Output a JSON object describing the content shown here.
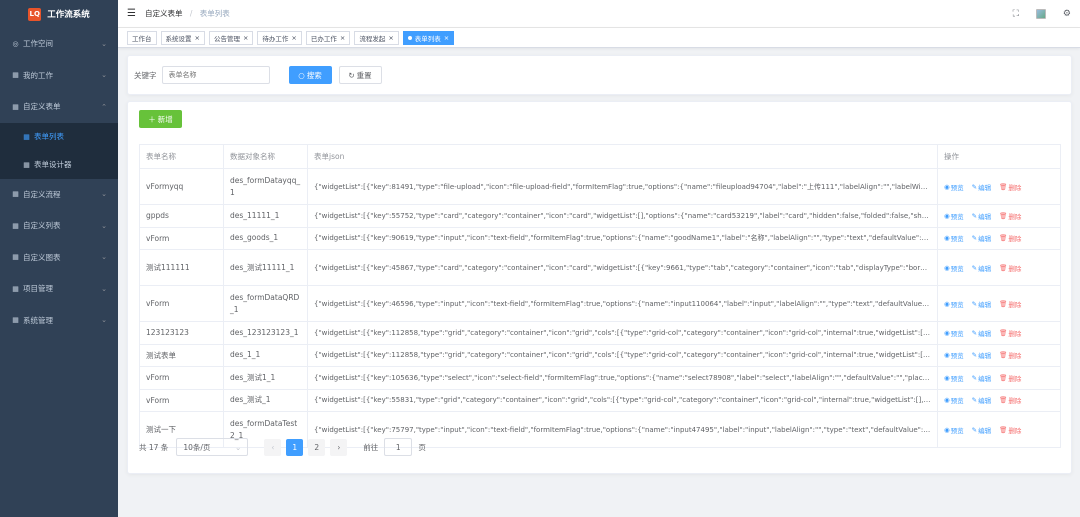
{
  "app": {
    "logo_mark": "LQ",
    "title": "工作流系统"
  },
  "sidebar": {
    "items": [
      {
        "icon": "◎",
        "label": "工作空间",
        "chev": "⌄"
      },
      {
        "icon": "▦",
        "label": "我的工作",
        "chev": "⌄"
      },
      {
        "icon": "▦",
        "label": "自定义表单",
        "chev": "⌃"
      },
      {
        "icon": "▦",
        "label": "自定义流程",
        "chev": "⌄"
      },
      {
        "icon": "▦",
        "label": "自定义列表",
        "chev": "⌄"
      },
      {
        "icon": "▦",
        "label": "自定义图表",
        "chev": "⌄"
      },
      {
        "icon": "▦",
        "label": "项目管理",
        "chev": "⌄"
      },
      {
        "icon": "▦",
        "label": "系统管理",
        "chev": "⌄"
      }
    ],
    "submenu": [
      {
        "icon": "▦",
        "label": "表单列表"
      },
      {
        "icon": "▦",
        "label": "表单设计器"
      }
    ]
  },
  "header": {
    "breadcrumb_1": "自定义表单",
    "breadcrumb_sep": "/",
    "breadcrumb_2": "表单列表"
  },
  "tabs": [
    {
      "label": "工作台",
      "close": ""
    },
    {
      "label": "系统设置",
      "close": "×"
    },
    {
      "label": "公告管理",
      "close": "×"
    },
    {
      "label": "待办工作",
      "close": "×"
    },
    {
      "label": "已办工作",
      "close": "×"
    },
    {
      "label": "流程发起",
      "close": "×"
    },
    {
      "label": "表单列表",
      "close": "×"
    }
  ],
  "search": {
    "keyword_label": "关键字",
    "placeholder": "表单名称",
    "search_label": "搜索",
    "reset_label": "重置"
  },
  "toolbar": {
    "add_label": "新增"
  },
  "table": {
    "headers": [
      "表单名称",
      "数据对象名称",
      "表单json",
      "操作"
    ],
    "ops": {
      "preview": "预览",
      "edit": "编辑",
      "delete": "删除"
    },
    "rows": [
      {
        "name": "vFormyqq",
        "obj": "des_formDatayqq_1",
        "json": "{\"widgetList\":[{\"key\":81491,\"type\":\"file-upload\",\"icon\":\"file-upload-field\",\"formItemFlag\":true,\"options\":{\"name\":\"fileupload94704\",\"label\":\"上传111\",\"labelAlign\":\"\",\"labelWidth\":null,"
      },
      {
        "name": "gppds",
        "obj": "des_11111_1",
        "json": "{\"widgetList\":[{\"key\":55752,\"type\":\"card\",\"category\":\"container\",\"icon\":\"card\",\"widgetList\":[],\"options\":{\"name\":\"card53219\",\"label\":\"card\",\"hidden\":false,\"folded\":false,\"showFold\":"
      },
      {
        "name": "vForm",
        "obj": "des_goods_1",
        "json": "{\"widgetList\":[{\"key\":90619,\"type\":\"input\",\"icon\":\"text-field\",\"formItemFlag\":true,\"options\":{\"name\":\"goodName1\",\"label\":\"名称\",\"labelAlign\":\"\",\"type\":\"text\",\"defaultValue\":\"\",\"placeholder\":"
      },
      {
        "name": "测试111111",
        "obj": "des_测试11111_1",
        "json": "{\"widgetList\":[{\"key\":45867,\"type\":\"card\",\"category\":\"container\",\"icon\":\"card\",\"widgetList\":[{\"key\":9661,\"type\":\"tab\",\"category\":\"container\",\"icon\":\"tab\",\"displayType\":\"border-card\""
      },
      {
        "name": "vForm",
        "obj": "des_formDataQRD_1",
        "json": "{\"widgetList\":[{\"key\":46596,\"type\":\"input\",\"icon\":\"text-field\",\"formItemFlag\":true,\"options\":{\"name\":\"input110064\",\"label\":\"input\",\"labelAlign\":\"\",\"type\":\"text\",\"defaultValue\":\"\",\"placeholder\":"
      },
      {
        "name": "123123123",
        "obj": "des_123123123_1",
        "json": "{\"widgetList\":[{\"key\":112858,\"type\":\"grid\",\"category\":\"container\",\"icon\":\"grid\",\"cols\":[{\"type\":\"grid-col\",\"category\":\"container\",\"icon\":\"grid-col\",\"internal\":true,\"widgetList\":[{\"key\":20"
      },
      {
        "name": "测试表单",
        "obj": "des_1_1",
        "json": "{\"widgetList\":[{\"key\":112858,\"type\":\"grid\",\"category\":\"container\",\"icon\":\"grid\",\"cols\":[{\"type\":\"grid-col\",\"category\":\"container\",\"icon\":\"grid-col\",\"internal\":true,\"widgetList\":[{\"key\":20"
      },
      {
        "name": "vForm",
        "obj": "des_测试1_1",
        "json": "{\"widgetList\":[{\"key\":105636,\"type\":\"select\",\"icon\":\"select-field\",\"formItemFlag\":true,\"options\":{\"name\":\"select78908\",\"label\":\"select\",\"labelAlign\":\"\",\"defaultValue\":\"\",\"placeholder\":"
      },
      {
        "name": "vForm",
        "obj": "des_测试_1",
        "json": "{\"widgetList\":[{\"key\":55831,\"type\":\"grid\",\"category\":\"container\",\"icon\":\"grid\",\"cols\":[{\"type\":\"grid-col\",\"category\":\"container\",\"icon\":\"grid-col\",\"internal\":true,\"widgetList\":[],\"options\":"
      },
      {
        "name": "测试一下",
        "obj": "des_formDataTest2_1",
        "json": "{\"widgetList\":[{\"key\":75797,\"type\":\"input\",\"icon\":\"text-field\",\"formItemFlag\":true,\"options\":{\"name\":\"input47495\",\"label\":\"input\",\"labelAlign\":\"\",\"type\":\"text\",\"defaultValue\":\"\",\"placeholder\":"
      }
    ]
  },
  "pagination": {
    "total": "共 17 条",
    "page_size": "10条/页",
    "prev": "‹",
    "pages": [
      "1",
      "2"
    ],
    "next": "›",
    "goto_label": "前往",
    "goto_value": "1",
    "goto_suffix": "页"
  }
}
